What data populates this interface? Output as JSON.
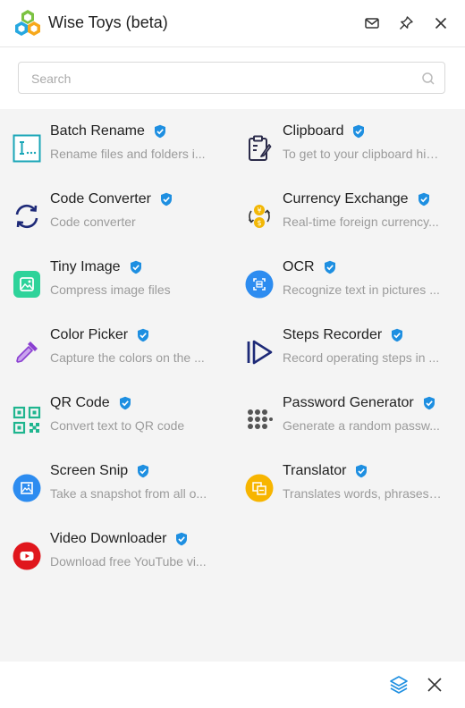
{
  "window": {
    "title": "Wise Toys (beta)",
    "logo_icon": "hexagon-cluster-logo",
    "actions": [
      {
        "name": "mail-icon"
      },
      {
        "name": "pin-icon"
      },
      {
        "name": "close-icon"
      }
    ]
  },
  "search": {
    "placeholder": "Search",
    "value": "",
    "icon": "search-icon"
  },
  "tools": [
    {
      "name": "Batch Rename",
      "desc": "Rename files and folders i...",
      "icon": "batch-rename-icon",
      "color": "#1aa6b7"
    },
    {
      "name": "Clipboard",
      "desc": "To get to your clipboard his...",
      "icon": "clipboard-icon",
      "color": "#2b2b4a"
    },
    {
      "name": "Code Converter",
      "desc": "Code converter",
      "icon": "code-converter-icon",
      "color": "#1e2a78"
    },
    {
      "name": "Currency Exchange",
      "desc": "Real-time foreign currency...",
      "icon": "currency-exchange-icon",
      "color": "#f2b705"
    },
    {
      "name": "Tiny Image",
      "desc": "Compress image files",
      "icon": "tiny-image-icon",
      "color": "#2ed39a"
    },
    {
      "name": "OCR",
      "desc": "Recognize text in pictures ...",
      "icon": "ocr-icon",
      "color": "#2d8cf0"
    },
    {
      "name": "Color Picker",
      "desc": "Capture the colors on the ...",
      "icon": "color-picker-icon",
      "color": "#8a3fd1"
    },
    {
      "name": "Steps Recorder",
      "desc": "Record operating steps in ...",
      "icon": "steps-recorder-icon",
      "color": "#1e2a78"
    },
    {
      "name": "QR Code",
      "desc": "Convert text to QR code",
      "icon": "qr-code-icon",
      "color": "#1fb58f"
    },
    {
      "name": "Password Generator",
      "desc": "Generate a random passw...",
      "icon": "password-generator-icon",
      "color": "#555555"
    },
    {
      "name": "Screen Snip",
      "desc": "Take a snapshot from all o...",
      "icon": "screen-snip-icon",
      "color": "#2d8cf0"
    },
    {
      "name": "Translator",
      "desc": "Translates words, phrases,...",
      "icon": "translator-icon",
      "color": "#f7b500"
    },
    {
      "name": "Video Downloader",
      "desc": "Download free YouTube vi...",
      "icon": "video-downloader-icon",
      "color": "#e0161c"
    }
  ],
  "verified_color": "#1e8fe1",
  "bottom": {
    "actions": [
      {
        "name": "layers-icon"
      },
      {
        "name": "close-icon"
      }
    ]
  }
}
